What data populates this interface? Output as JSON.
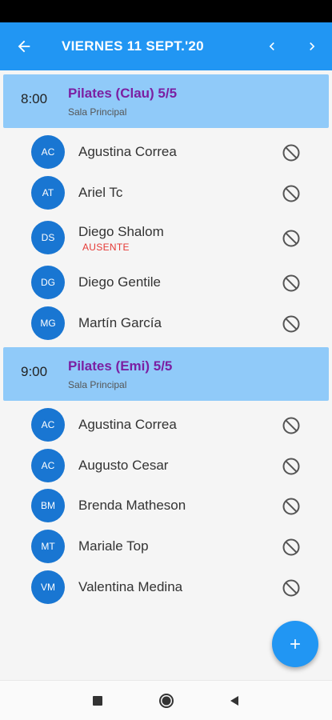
{
  "app_bar": {
    "title": "VIERNES 11 SEPT.'20",
    "back_icon": "arrow-left-icon",
    "prev_icon": "chevron-left-icon",
    "next_icon": "chevron-right-icon"
  },
  "classes": [
    {
      "time": "8:00",
      "name": "Pilates (Clau) 5/5",
      "room": "Sala Principal",
      "attendees": [
        {
          "initials": "AC",
          "name": "Agustina Correa",
          "status": ""
        },
        {
          "initials": "AT",
          "name": "Ariel Tc",
          "status": ""
        },
        {
          "initials": "DS",
          "name": "Diego Shalom",
          "status": "AUSENTE"
        },
        {
          "initials": "DG",
          "name": "Diego Gentile",
          "status": ""
        },
        {
          "initials": "MG",
          "name": "Martín García",
          "status": ""
        }
      ]
    },
    {
      "time": "9:00",
      "name": "Pilates (Emi) 5/5",
      "room": "Sala Principal",
      "attendees": [
        {
          "initials": "AC",
          "name": "Agustina Correa",
          "status": ""
        },
        {
          "initials": "AC",
          "name": "Augusto Cesar",
          "status": ""
        },
        {
          "initials": "BM",
          "name": "Brenda Matheson",
          "status": ""
        },
        {
          "initials": "MT",
          "name": "Mariale Top",
          "status": ""
        },
        {
          "initials": "VM",
          "name": "Valentina Medina",
          "status": ""
        }
      ]
    }
  ],
  "fab": {
    "icon": "plus-icon"
  },
  "colors": {
    "primary": "#2196f3",
    "class_header_bg": "#90caf9",
    "class_name": "#7b1fa2",
    "avatar": "#1976d2",
    "absent": "#e53935"
  }
}
